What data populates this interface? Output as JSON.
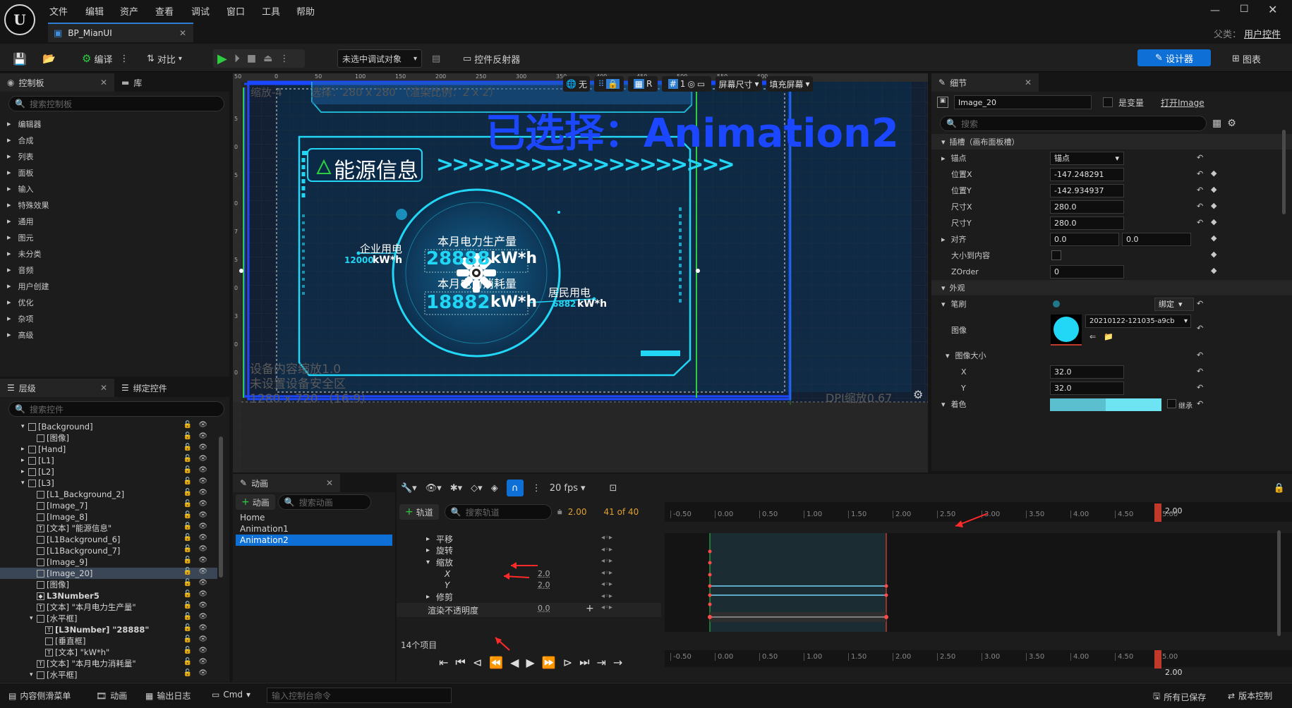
{
  "app": {
    "menu": [
      "文件",
      "编辑",
      "资产",
      "查看",
      "调试",
      "窗口",
      "工具",
      "帮助"
    ],
    "tab_title": "BP_MianUI",
    "parent_label": "父类：",
    "parent_value": "用户控件",
    "logo_text": "U"
  },
  "toolbar": {
    "compile": "编译",
    "diff": "对比",
    "debug_target": "未选中调试对象",
    "widget_reflector": "控件反射器",
    "designer": "设计器",
    "graph": "图表"
  },
  "palette": {
    "tab": "控制板",
    "tab2": "库",
    "search_placeholder": "搜索控制板",
    "categories": [
      "编辑器",
      "合成",
      "列表",
      "面板",
      "输入",
      "特殊效果",
      "通用",
      "图元",
      "未分类",
      "音频",
      "用户创建",
      "优化",
      "杂项",
      "高级"
    ]
  },
  "hierarchy": {
    "tab": "层级",
    "tab2": "绑定控件",
    "search_placeholder": "搜索控件",
    "items": [
      {
        "label": "[Background]",
        "indent": 1,
        "exp": "▾",
        "icon": ""
      },
      {
        "label": "[图像]",
        "indent": 2,
        "exp": "",
        "icon": ""
      },
      {
        "label": "[Hand]",
        "indent": 1,
        "exp": "▸",
        "icon": ""
      },
      {
        "label": "[L1]",
        "indent": 1,
        "exp": "▸",
        "icon": ""
      },
      {
        "label": "[L2]",
        "indent": 1,
        "exp": "▸",
        "icon": ""
      },
      {
        "label": "[L3]",
        "indent": 1,
        "exp": "▾",
        "icon": ""
      },
      {
        "label": "[L1_Background_2]",
        "indent": 2,
        "exp": "",
        "icon": ""
      },
      {
        "label": "[Image_7]",
        "indent": 2,
        "exp": "",
        "icon": ""
      },
      {
        "label": "[Image_8]",
        "indent": 2,
        "exp": "",
        "icon": ""
      },
      {
        "label": "[文本] \"能源信息\"",
        "indent": 2,
        "exp": "",
        "icon": "T"
      },
      {
        "label": "[L1Background_6]",
        "indent": 2,
        "exp": "",
        "icon": ""
      },
      {
        "label": "[L1Background_7]",
        "indent": 2,
        "exp": "",
        "icon": ""
      },
      {
        "label": "[Image_9]",
        "indent": 2,
        "exp": "",
        "icon": ""
      },
      {
        "label": "[Image_20]",
        "indent": 2,
        "exp": "",
        "icon": "",
        "selected": true
      },
      {
        "label": "[图像]",
        "indent": 2,
        "exp": "",
        "icon": ""
      },
      {
        "label": "L3Number5",
        "indent": 2,
        "exp": "",
        "icon": "◆",
        "bold": true
      },
      {
        "label": "[文本] \"本月电力生产量\"",
        "indent": 2,
        "exp": "",
        "icon": "T"
      },
      {
        "label": "[水平框]",
        "indent": 2,
        "exp": "▾",
        "icon": ""
      },
      {
        "label": "[L3Number] \"28888\"",
        "indent": 3,
        "exp": "",
        "icon": "T",
        "bold": true
      },
      {
        "label": "[垂直框]",
        "indent": 3,
        "exp": "",
        "icon": ""
      },
      {
        "label": "[文本] \"kW*h\"",
        "indent": 3,
        "exp": "",
        "icon": "T"
      },
      {
        "label": "[文本] \"本月电力消耗量\"",
        "indent": 2,
        "exp": "",
        "icon": "T"
      },
      {
        "label": "[水平框]",
        "indent": 2,
        "exp": "▾",
        "icon": ""
      }
    ]
  },
  "viewport": {
    "zoom": "缩放-4",
    "selection": "选择：280 x 280 （渲染比例：2 x 2）",
    "big_overlay": "已选择：Animation2",
    "scale_info": "设备内容缩放1.0",
    "safe_zone": "未设置设备安全区",
    "resolution": "1280 x 720 （16:9）",
    "dpi": "DPI缩放0.67",
    "btn_none": "无",
    "btn_r": "R",
    "btn_1": "1",
    "screen_size": "屏幕尺寸",
    "fill_screen": "填充屏幕",
    "ruler_top": [
      "50",
      "0",
      "50",
      "100",
      "150",
      "200",
      "250",
      "300",
      "350",
      "400",
      "450",
      "500",
      "550",
      "600"
    ],
    "ruler_left": [
      "5",
      "0",
      "5",
      "0",
      "7",
      "5",
      "0",
      "3",
      "0",
      "0"
    ],
    "hud": {
      "title": "能源信息",
      "arrows": ">>>>>>>>>>>>>>>>>>>",
      "production_label": "本月电力生产量",
      "production_value": "28888",
      "unit": "kW*h",
      "consumption_label": "本月电力消耗量",
      "consumption_value": "18882",
      "enterprise_label": "企业用电",
      "enterprise_value": "12000",
      "resident_label": "居民用电",
      "resident_value": "6882"
    }
  },
  "details": {
    "tab": "细节",
    "name": "Image_20",
    "is_variable": "是变量",
    "open": "打开Image",
    "search_placeholder": "搜索",
    "slot_section": "插槽（画布面板槽）",
    "anchors_label": "锚点",
    "anchors_value": "锚点",
    "pos_x_label": "位置X",
    "pos_x": "-147.248291",
    "pos_y_label": "位置Y",
    "pos_y": "-142.934937",
    "size_x_label": "尺寸X",
    "size_x": "280.0",
    "size_y_label": "尺寸Y",
    "size_y": "280.0",
    "align_label": "对齐",
    "align_x": "0.0",
    "align_y": "0.0",
    "size_to_content": "大小到内容",
    "zorder_label": "ZOrder",
    "zorder": "0",
    "appearance": "外观",
    "brush": "笔刷",
    "bind": "绑定",
    "image_label": "图像",
    "image_asset": "20210122-121035-a9cb",
    "image_size": "图像大小",
    "x_label": "X",
    "x_value": "32.0",
    "y_label": "Y",
    "y_value": "32.0",
    "tint": "着色",
    "inherit": "继承"
  },
  "animations": {
    "tab": "动画",
    "add": "动画",
    "search_placeholder": "搜索动画",
    "items": [
      "Home",
      "Animation1",
      "Animation2"
    ],
    "selected": 2
  },
  "sequencer": {
    "fps": "20 fps",
    "add_track": "轨道",
    "search_placeholder": "搜索轨道",
    "current_time": "2.00",
    "frames": "41 of 40",
    "items_count": "14个项目",
    "tracks": [
      {
        "label": "平移",
        "exp": "▸",
        "indent": 1,
        "value": ""
      },
      {
        "label": "旋转",
        "exp": "▸",
        "indent": 1,
        "value": ""
      },
      {
        "label": "缩放",
        "exp": "▾",
        "indent": 1,
        "value": ""
      },
      {
        "label": "X",
        "exp": "",
        "indent": 2,
        "value": "2.0",
        "italic": true
      },
      {
        "label": "Y",
        "exp": "",
        "indent": 2,
        "value": "2.0",
        "italic": true
      },
      {
        "label": "修剪",
        "exp": "▸",
        "indent": 1,
        "value": ""
      },
      {
        "label": "渲染不透明度",
        "exp": "",
        "indent": 0,
        "value": "0.0"
      }
    ],
    "ruler": [
      "-0.50",
      "0.00",
      "0.50",
      "1.00",
      "1.50",
      "2.00",
      "2.50",
      "3.00",
      "3.50",
      "4.00",
      "4.50",
      "5.00"
    ],
    "playhead": "2.00"
  },
  "statusbar": {
    "content_drawer": "内容侧滑菜单",
    "anim": "动画",
    "output_log": "输出日志",
    "cmd": "Cmd",
    "console_placeholder": "输入控制台命令",
    "saved": "所有已保存",
    "source_control": "版本控制"
  },
  "colors": {
    "accent": "#2d7dd2",
    "hud_cyan": "#22d6f5",
    "selection_blue": "#1a47ff",
    "guide_green": "#2ecc40",
    "playhead": "#c0392b",
    "arrow_red": "#ff2a2a"
  }
}
